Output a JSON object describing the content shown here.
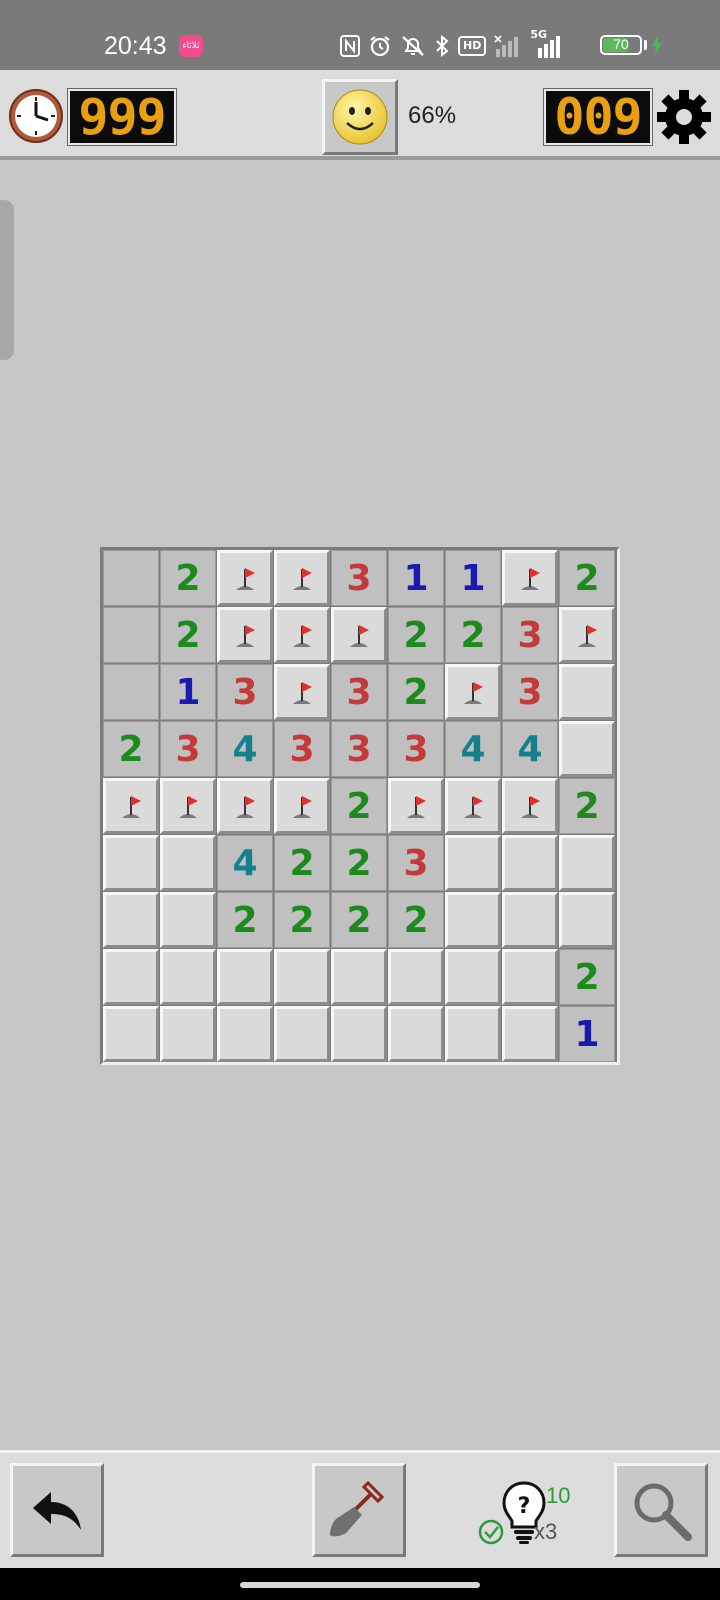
{
  "status_bar": {
    "time": "20:43",
    "app_badge": "ثلاثاء",
    "hd_label": "HD",
    "network_label": "5G",
    "battery": "70",
    "battery_level": 0.7,
    "icons": [
      "nfc-icon",
      "alarm-icon",
      "mute-icon",
      "bluetooth-icon",
      "hd-voice-icon",
      "signal-icon",
      "signal-5g-icon",
      "battery-icon",
      "charging-icon"
    ]
  },
  "header": {
    "timer": "999",
    "progress": "66%",
    "mines_left": "009"
  },
  "colors": {
    "n1": "#1a1ab0",
    "n2": "#1d8a1d",
    "n3": "#c23a3a",
    "n4": "#13808c",
    "flag": "#e03030",
    "led": "#e8a010",
    "smiley": "#f5dc4a"
  },
  "board": {
    "rows": 9,
    "cols": 9,
    "cells": [
      [
        "e",
        "2",
        "F",
        "F",
        "3",
        "1",
        "1",
        "F",
        "2"
      ],
      [
        "e",
        "2",
        "F",
        "F",
        "F",
        "2",
        "2",
        "3",
        "F"
      ],
      [
        "e",
        "1",
        "3",
        "F",
        "3",
        "2",
        "F",
        "3",
        "c"
      ],
      [
        "2",
        "3",
        "4",
        "3",
        "3",
        "3",
        "4",
        "4",
        "c"
      ],
      [
        "F",
        "F",
        "F",
        "F",
        "2",
        "F",
        "F",
        "F",
        "2"
      ],
      [
        "c",
        "c",
        "4",
        "2",
        "2",
        "3",
        "c",
        "c",
        "c"
      ],
      [
        "c",
        "c",
        "2",
        "2",
        "2",
        "2",
        "c",
        "c",
        "c"
      ],
      [
        "c",
        "c",
        "c",
        "c",
        "c",
        "c",
        "c",
        "c",
        "2"
      ],
      [
        "c",
        "c",
        "c",
        "c",
        "c",
        "c",
        "c",
        "c",
        "1"
      ]
    ]
  },
  "toolbar": {
    "hint_count": "10",
    "hint_multiplier": "x3",
    "hint_question": "?"
  }
}
